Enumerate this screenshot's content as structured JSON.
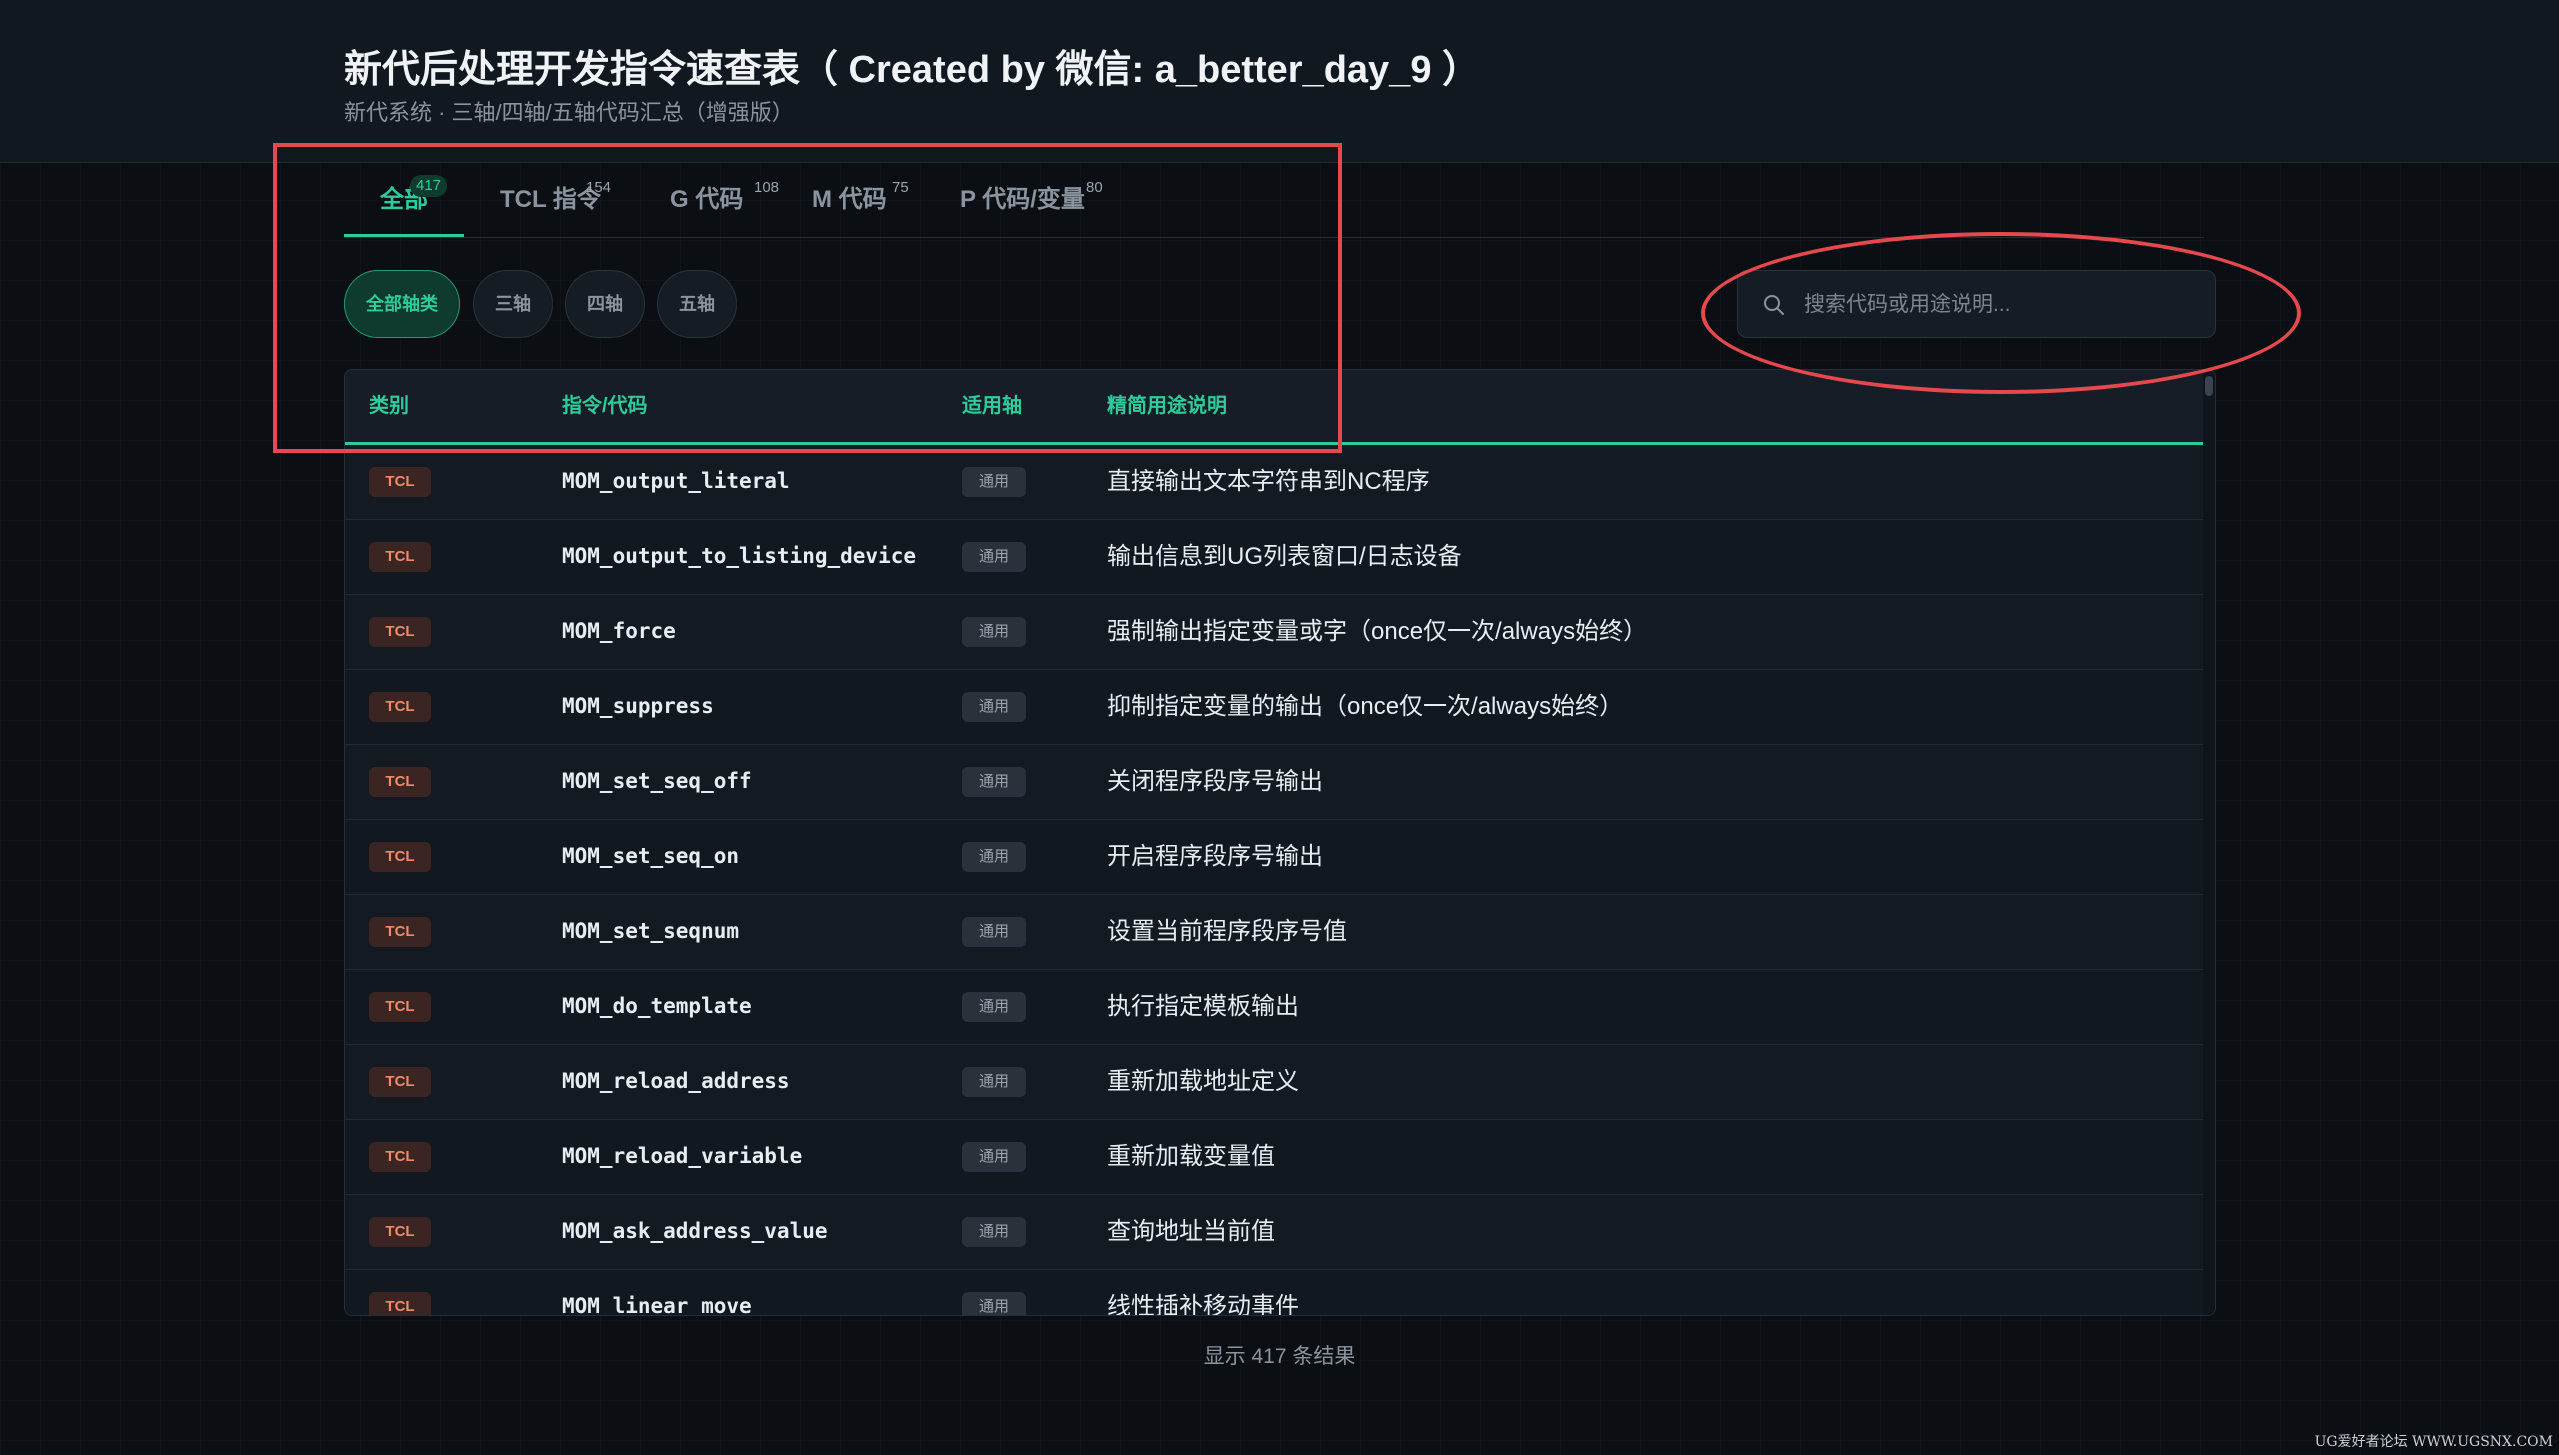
{
  "header": {
    "title": "新代后处理开发指令速查表（ Created by 微信: a_better_day_9 ）",
    "subtitle": "新代系统 · 三轴/四轴/五轴代码汇总（增强版）"
  },
  "tabs": [
    {
      "label": "全部",
      "count": "417",
      "active": true
    },
    {
      "label": "TCL 指令",
      "count": "154",
      "active": false
    },
    {
      "label": "G 代码",
      "count": "108",
      "active": false
    },
    {
      "label": "M 代码",
      "count": "75",
      "active": false
    },
    {
      "label": "P 代码/变量",
      "count": "80",
      "active": false
    }
  ],
  "axis_filters": [
    {
      "label": "全部轴类",
      "active": true
    },
    {
      "label": "三轴",
      "active": false
    },
    {
      "label": "四轴",
      "active": false
    },
    {
      "label": "五轴",
      "active": false
    }
  ],
  "search": {
    "placeholder": "搜索代码或用途说明...",
    "value": "",
    "icon": "search-icon"
  },
  "table": {
    "headers": {
      "category": "类别",
      "code": "指令/代码",
      "axis": "适用轴",
      "description": "精简用途说明"
    },
    "rows": [
      {
        "category": "TCL",
        "code": "MOM_output_literal",
        "axis": "通用",
        "description": "直接输出文本字符串到NC程序"
      },
      {
        "category": "TCL",
        "code": "MOM_output_to_listing_device",
        "axis": "通用",
        "description": "输出信息到UG列表窗口/日志设备"
      },
      {
        "category": "TCL",
        "code": "MOM_force",
        "axis": "通用",
        "description": "强制输出指定变量或字（once仅一次/always始终）"
      },
      {
        "category": "TCL",
        "code": "MOM_suppress",
        "axis": "通用",
        "description": "抑制指定变量的输出（once仅一次/always始终）"
      },
      {
        "category": "TCL",
        "code": "MOM_set_seq_off",
        "axis": "通用",
        "description": "关闭程序段序号输出"
      },
      {
        "category": "TCL",
        "code": "MOM_set_seq_on",
        "axis": "通用",
        "description": "开启程序段序号输出"
      },
      {
        "category": "TCL",
        "code": "MOM_set_seqnum",
        "axis": "通用",
        "description": "设置当前程序段序号值"
      },
      {
        "category": "TCL",
        "code": "MOM_do_template",
        "axis": "通用",
        "description": "执行指定模板输出"
      },
      {
        "category": "TCL",
        "code": "MOM_reload_address",
        "axis": "通用",
        "description": "重新加载地址定义"
      },
      {
        "category": "TCL",
        "code": "MOM_reload_variable",
        "axis": "通用",
        "description": "重新加载变量值"
      },
      {
        "category": "TCL",
        "code": "MOM_ask_address_value",
        "axis": "通用",
        "description": "查询地址当前值"
      },
      {
        "category": "TCL",
        "code": "MOM_linear_move",
        "axis": "通用",
        "description": "线性插补移动事件"
      }
    ]
  },
  "footer": {
    "result_count": "显示 417 条结果"
  },
  "watermark": "UG爱好者论坛 WWW.UGSNX.COM",
  "colors": {
    "accent": "#2ecc9a",
    "tcl_badge_text": "#ef8a6a",
    "annotation": "#e5484d"
  }
}
